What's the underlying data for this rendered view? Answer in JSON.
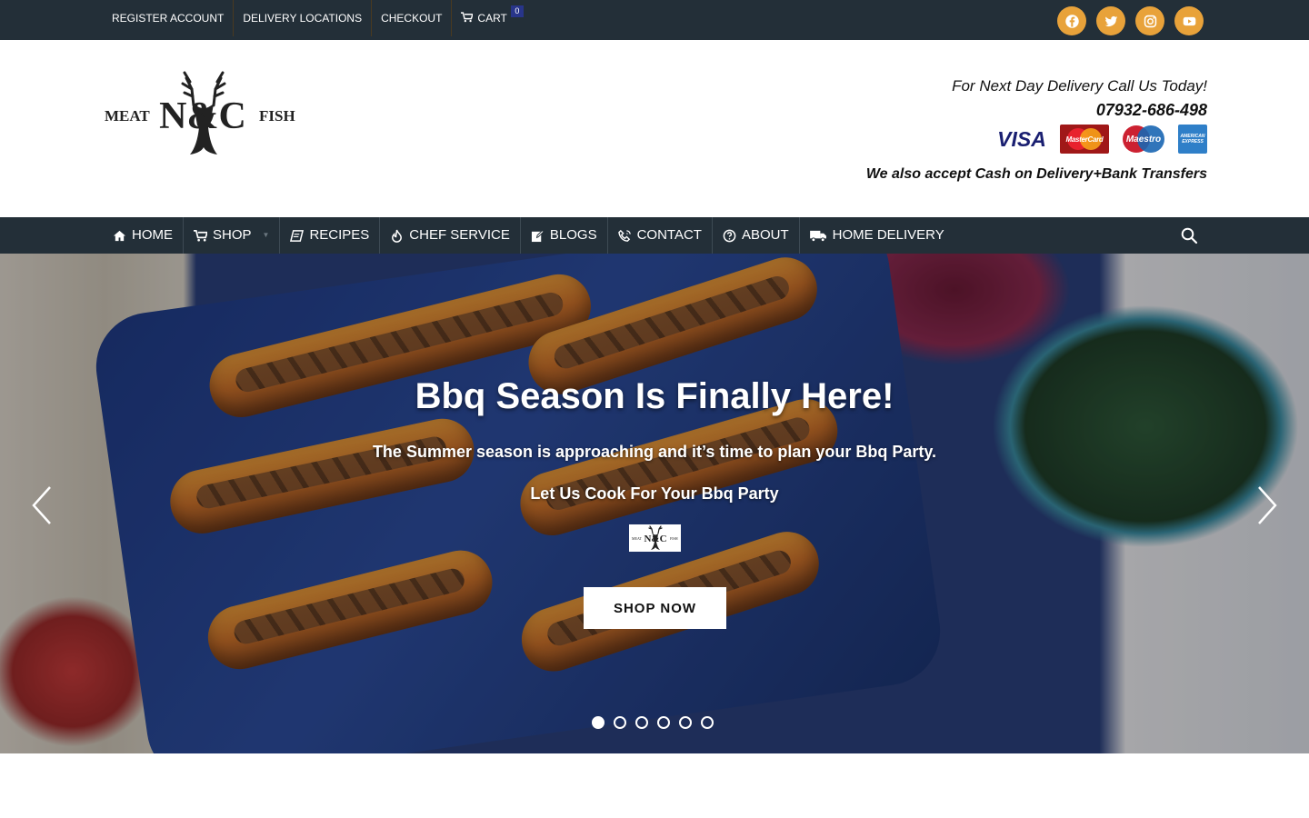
{
  "topbar": {
    "links": [
      "REGISTER ACCOUNT",
      "DELIVERY LOCATIONS",
      "CHECKOUT"
    ],
    "cart_label": "CART",
    "cart_count": "0",
    "socials": [
      "facebook-icon",
      "twitter-icon",
      "instagram-icon",
      "youtube-icon"
    ],
    "social_color": "#e8a23a"
  },
  "header": {
    "logo_left": "MEAT",
    "logo_center": "N&C",
    "logo_right": "FISH",
    "call_text": "For Next Day Delivery Call Us Today!",
    "phone": "07932-686-498",
    "cards": [
      "VISA",
      "MasterCard",
      "Maestro",
      "AMERICAN EXPRESS"
    ],
    "accept_text": "We also accept Cash on Delivery+Bank Transfers"
  },
  "nav": {
    "items": [
      {
        "label": "HOME",
        "icon": "home-icon"
      },
      {
        "label": "SHOP",
        "icon": "cart-icon"
      },
      {
        "label": "RECIPES",
        "icon": "book-icon"
      },
      {
        "label": "CHEF SERVICE",
        "icon": "flame-icon"
      },
      {
        "label": "BLOGS",
        "icon": "edit-icon"
      },
      {
        "label": "CONTACT",
        "icon": "phone-icon"
      },
      {
        "label": "ABOUT",
        "icon": "help-icon"
      },
      {
        "label": "HOME DELIVERY",
        "icon": "truck-icon"
      }
    ],
    "background": "#232f38"
  },
  "hero": {
    "title": "Bbq Season Is Finally Here!",
    "subtitle": "The Summer season is approaching and it’s time to plan your Bbq Party.",
    "subtitle2": "Let Us Cook For Your Bbq Party",
    "button_label": "SHOP NOW",
    "slide_count": 6,
    "active_slide": 1
  }
}
